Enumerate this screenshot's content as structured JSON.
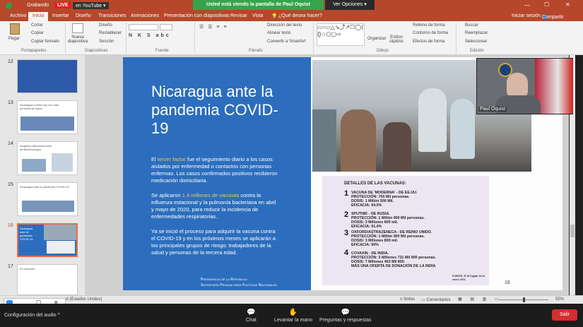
{
  "title_bar": {
    "recording": "Grabando",
    "live": "LIVE",
    "youtube": "en YouTube",
    "share_notice": "Usted está viendo la pantalla de Paul Oquist",
    "view_options": "Ver Opciones"
  },
  "ribbon_tabs": [
    "Archivo",
    "Inicio",
    "Insertar",
    "Diseño",
    "Transiciones",
    "Animaciones",
    "Presentación con diapositivas",
    "Revisar",
    "Vista",
    "¿Qué desea hacer?",
    "Iniciar sesión",
    "Compartir"
  ],
  "ribbon": {
    "pegar": "Pegar",
    "cortar": "Cortar",
    "copiar": "Copiar",
    "copiar_formato": "Copiar formato",
    "portapapeles": "Portapapeles",
    "nueva_diapositiva": "Nueva diapositiva",
    "diseno": "Diseño",
    "restablecer": "Restablecer",
    "seccion": "Sección",
    "diapositivas": "Diapositivas",
    "fuente": "Fuente",
    "direccion_texto": "Dirección del texto",
    "alinear_texto": "Alinear texto",
    "convertir_smartart": "Convertir a SmartArt",
    "parrafo": "Párrafo",
    "organizar": "Organizar",
    "estilos_rapidos": "Estilos rápidos",
    "relleno_forma": "Relleno de forma",
    "contorno_forma": "Contorno de forma",
    "efectos_forma": "Efectos de forma",
    "dibujo": "Dibujo",
    "buscar": "Buscar",
    "reemplazar": "Reemplazar",
    "seleccionar": "Seleccionar",
    "edicion": "Edición"
  },
  "thumbnails": [
    {
      "num": "12",
      "text": ""
    },
    {
      "num": "13",
      "text": "Nicaragua cuenta hoy con más personal de salud"
    },
    {
      "num": "14",
      "text": "Hospital Latinoamericano de Biotecnología"
    },
    {
      "num": "15",
      "text": "Nicaragua ante la pandemia COVID-19"
    },
    {
      "num": "16",
      "text": "Nicaragua ante la pandemia COVID-19"
    },
    {
      "num": "17",
      "text": "En resumen"
    }
  ],
  "slide": {
    "title": "Nicaragua ante la pandemia COVID-19",
    "p1_pre": "El ",
    "p1_hl": "tercer factor",
    "p1_post": " fue el seguimiento diario a los casos aislados por enfermedad o contactos con personas enfermas. Los casos confirmados positivos recibieron medicación domiciliaria.",
    "p2_pre": "Se aplicaron ",
    "p2_hl": "1.4 millones de vacunas",
    "p2_post": " contra la influenza estacional y la pulmonía bacteriana en abril y mayo de 2020, para reducir la incidencia de enfermedades respiratorias.",
    "p3": "Ya se inició el proceso para adquirir la vacuna contra el COVID-19 y en los próximos meses se aplicarán a los principales grupos de riesgo: trabajadores de la salud y personas de la tercera edad.",
    "footer1": "Presidencia de la República",
    "footer2": "Secretaría Privada para Políticas Nacionales",
    "page_number": "16"
  },
  "vaccines": {
    "heading": "DETALLES DE LAS VACUNAS:",
    "items": [
      {
        "num": "1",
        "name": "VACUNA DE 'MODERNA' - DE EE.UU.",
        "l1": "PROTECCIÓN: 750 Mil personas.",
        "l2": "DOSIS: 1 Millón 500 Mil.",
        "l3": "EFICACIA: 94.5%"
      },
      {
        "num": "2",
        "name": "SPUTNIK - DE RUSIA.",
        "l1": "PROTECCIÓN: 1 Millón 900 Mil personas.",
        "l2": "DOSIS: 3 Millones 800 mil.",
        "l3": "EFICACIA: 91.4%"
      },
      {
        "num": "3",
        "name": "OXFORD/ASTRAZENECA - DE REINO UNIDO.",
        "l1": "PROTECCIÓN: 1 Millón 900 Mil personas.",
        "l2": "DOSIS: 3 Millones 800 mil.",
        "l3": "EFICACIA: 90%"
      },
      {
        "num": "4",
        "name": "COVAXIN - DE INDIA.",
        "l1": "PROTECCIÓN: 3 Millones 731 Mil 900 personas.",
        "l2": "DOSIS: 7 Millones 463 Mil 800.",
        "l3": "MÁS UNA OFERTA DE DONACIÓN DE LA INDIA"
      }
    ],
    "source": "FUENTE: R.19 Digital 13 de enero 2021"
  },
  "video": {
    "name": "Paul Oquist"
  },
  "status": {
    "language": "ol (Estados Unidos)",
    "notes": "Notas",
    "comments": "Comentarios",
    "zoom": "55%"
  },
  "zoom_controls": {
    "audio_config": "Configuración del audio",
    "chat": "Chat",
    "raise_hand": "Levantar la mano",
    "qa": "Preguntas y respuestas",
    "leave": "Salir"
  }
}
